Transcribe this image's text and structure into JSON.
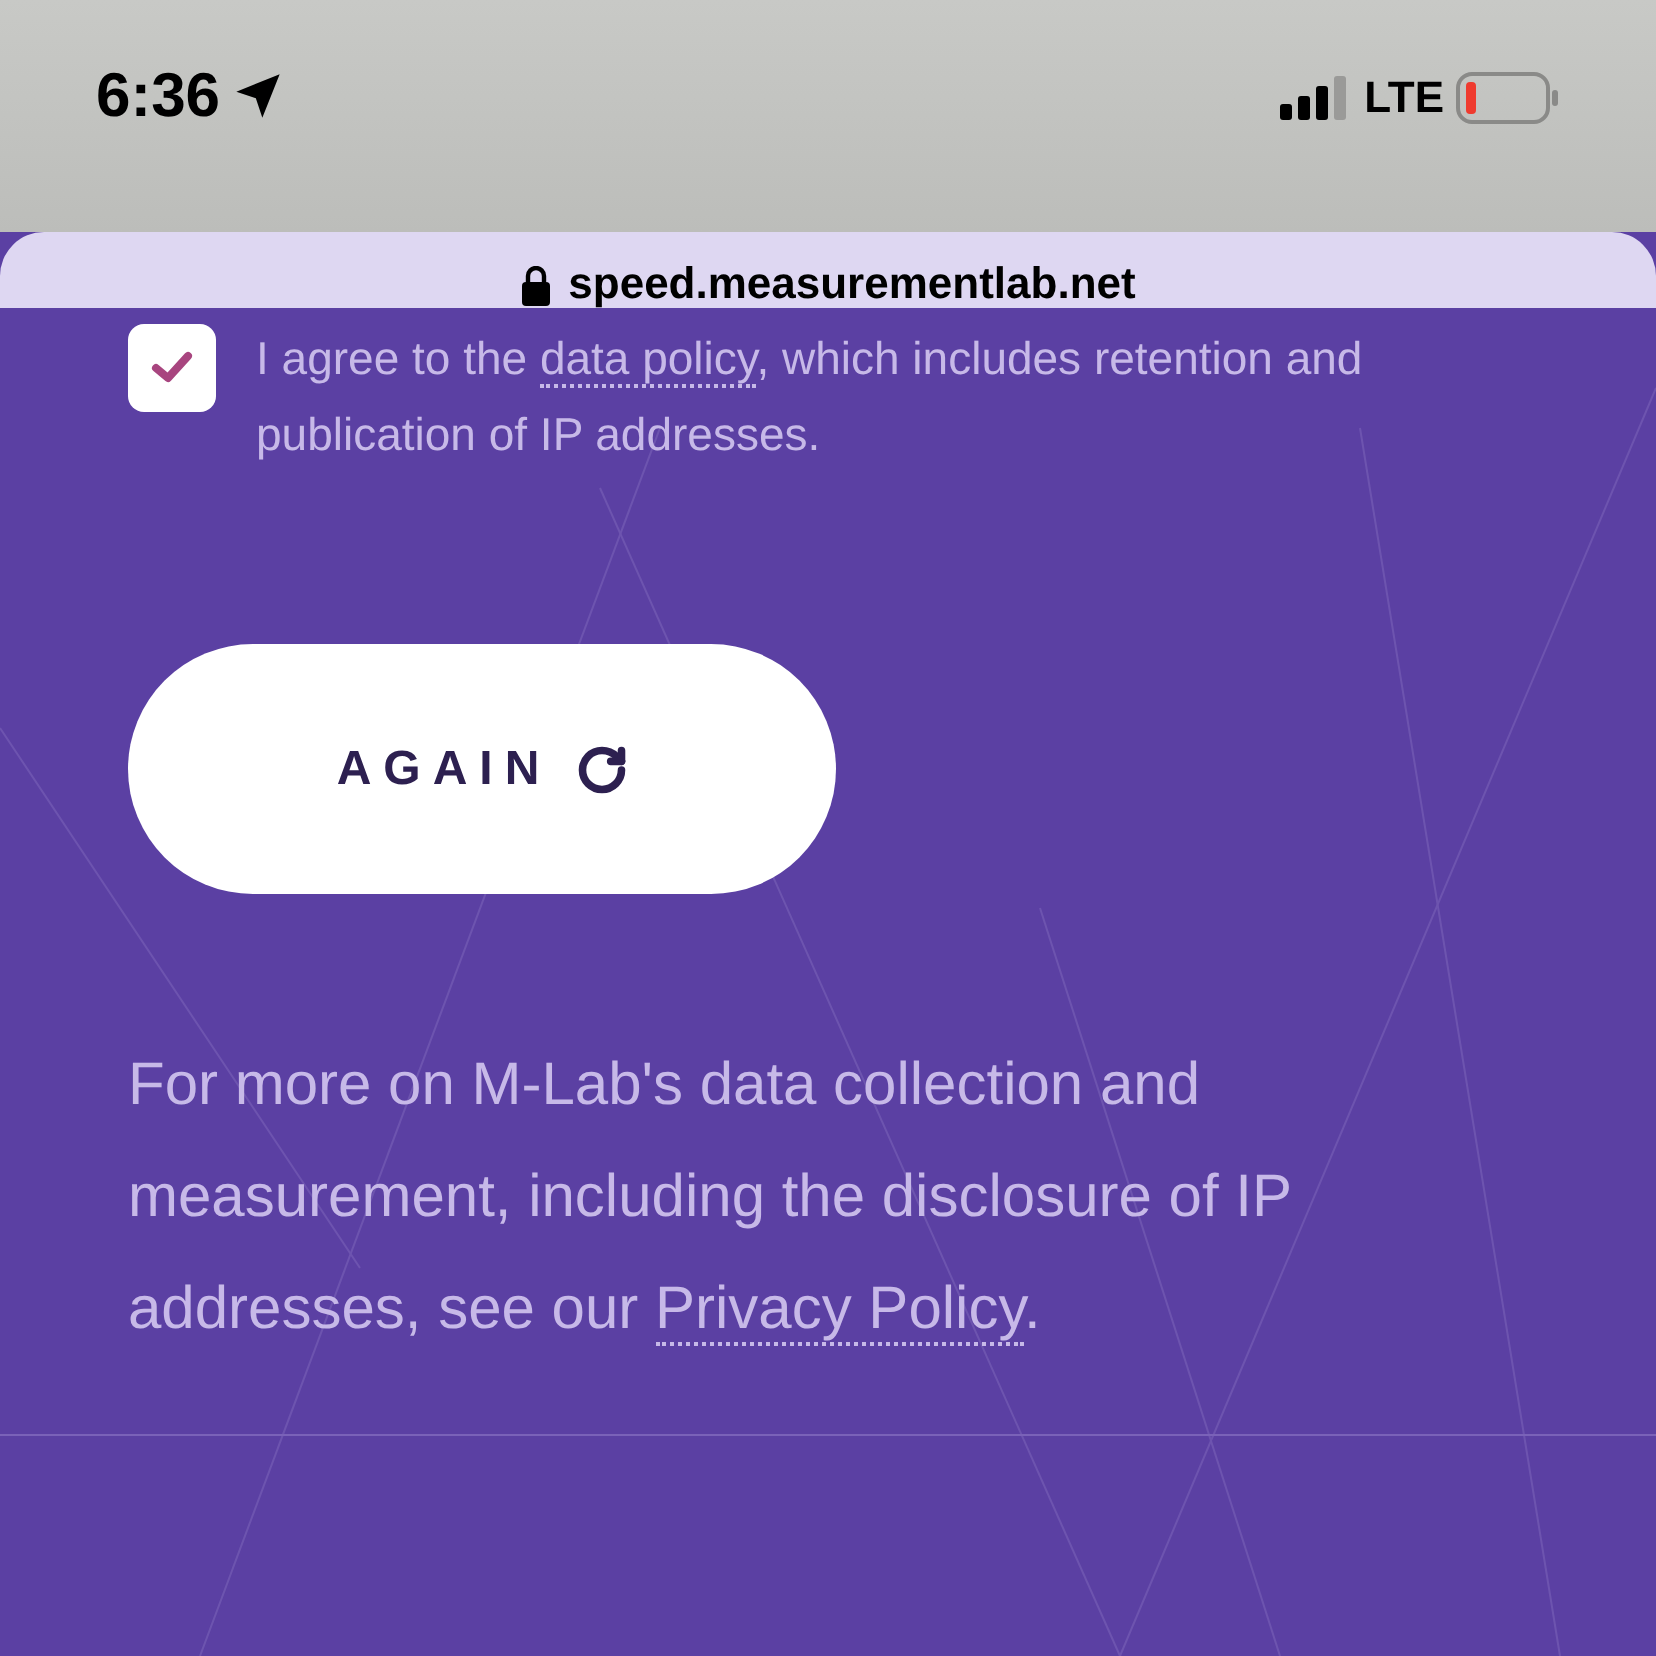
{
  "status_bar": {
    "time": "6:36",
    "network": "LTE"
  },
  "address_bar": {
    "url": "speed.measurementlab.net"
  },
  "consent": {
    "checked": true,
    "text_before": "I agree to the",
    "link": "data policy",
    "text_after": ", which includes retention and publication of IP addresses."
  },
  "again_button": {
    "label": "AGAIN"
  },
  "privacy_note": {
    "text_before": "For more on M-Lab's data collection and measurement, including the disclosure of IP addresses, see our",
    "link": "Privacy Policy",
    "text_after": "."
  }
}
